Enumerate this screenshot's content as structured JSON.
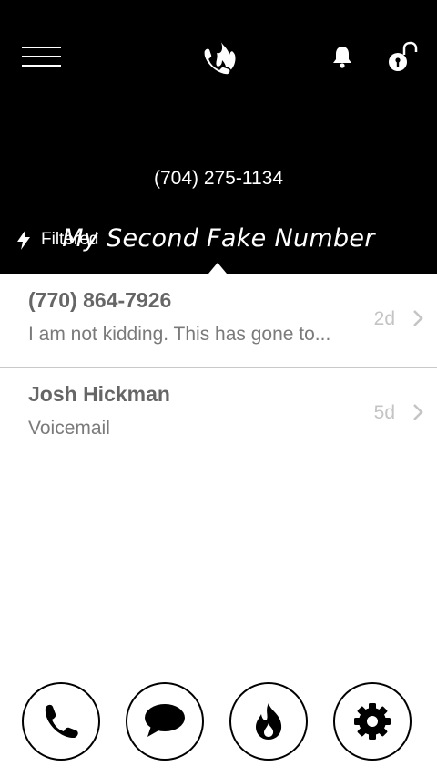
{
  "header": {
    "own_number": "(704) 275-1134",
    "filter_label": "Filtered",
    "line_name": "My Second Fake Number"
  },
  "conversations": [
    {
      "title": "(770) 864-7926",
      "preview": "I am not kidding. This has gone to...",
      "age": "2d"
    },
    {
      "title": "Josh Hickman",
      "preview": "Voicemail",
      "age": "5d"
    }
  ],
  "icons": {
    "menu": "hamburger-menu-icon",
    "logo": "phone-flame-logo",
    "bell": "bell-icon",
    "lock": "unlocked-padlock-icon",
    "filter": "lightning-bolt-icon",
    "chevron": "chevron-right-icon",
    "bottom_buttons": [
      "phone-icon",
      "chat-bubble-icon",
      "flame-icon",
      "gear-icon"
    ]
  },
  "colors": {
    "header_bg": "#000000",
    "title_text": "#666666",
    "preview_text": "#7a7a7a",
    "age_text": "#c4c4c4"
  }
}
